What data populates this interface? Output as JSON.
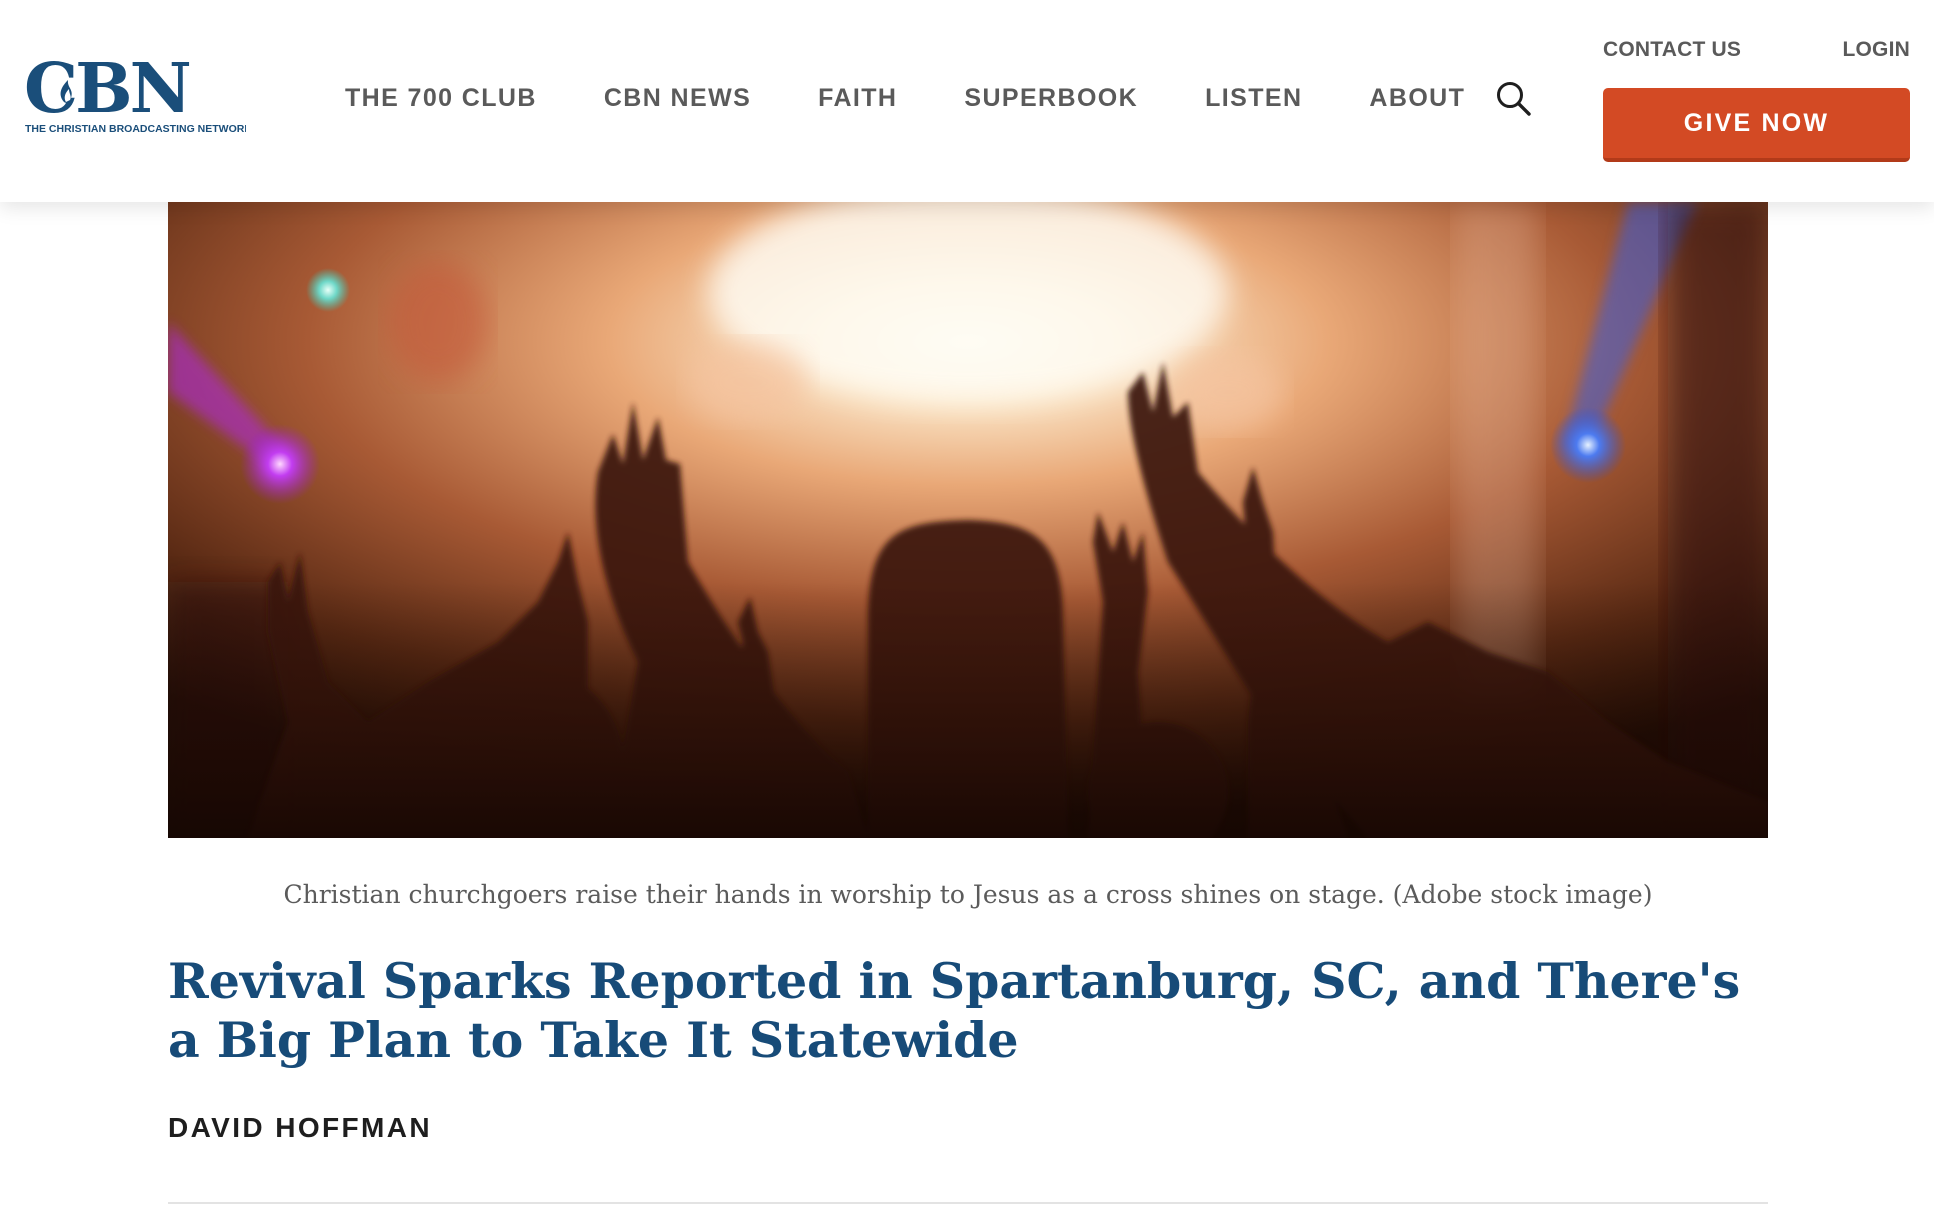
{
  "header": {
    "logo": {
      "mark": "CBN",
      "tagline": "THE CHRISTIAN BROADCASTING NETWORK",
      "brand_color": "#1a4e7a"
    },
    "nav": [
      {
        "label": "THE 700 CLUB"
      },
      {
        "label": "CBN NEWS"
      },
      {
        "label": "FAITH"
      },
      {
        "label": "SUPERBOOK"
      },
      {
        "label": "LISTEN"
      },
      {
        "label": "ABOUT"
      }
    ],
    "search_icon": "search-icon",
    "utility": {
      "contact": "CONTACT US",
      "login": "LOGIN"
    },
    "give_button": {
      "label": "GIVE NOW",
      "color": "#d34a24"
    }
  },
  "article": {
    "hero_image": {
      "alt": "Christian churchgoers raise their hands in worship to Jesus as a cross shines on stage. (Adobe stock image)"
    },
    "caption": "Christian churchgoers raise their hands in worship to Jesus as a cross shines on stage. (Adobe stock image)",
    "headline": "Revival Sparks Reported in Spartanburg, SC, and There's a Big Plan to Take It Statewide",
    "headline_color": "#174b78",
    "author": "DAVID HOFFMAN"
  }
}
